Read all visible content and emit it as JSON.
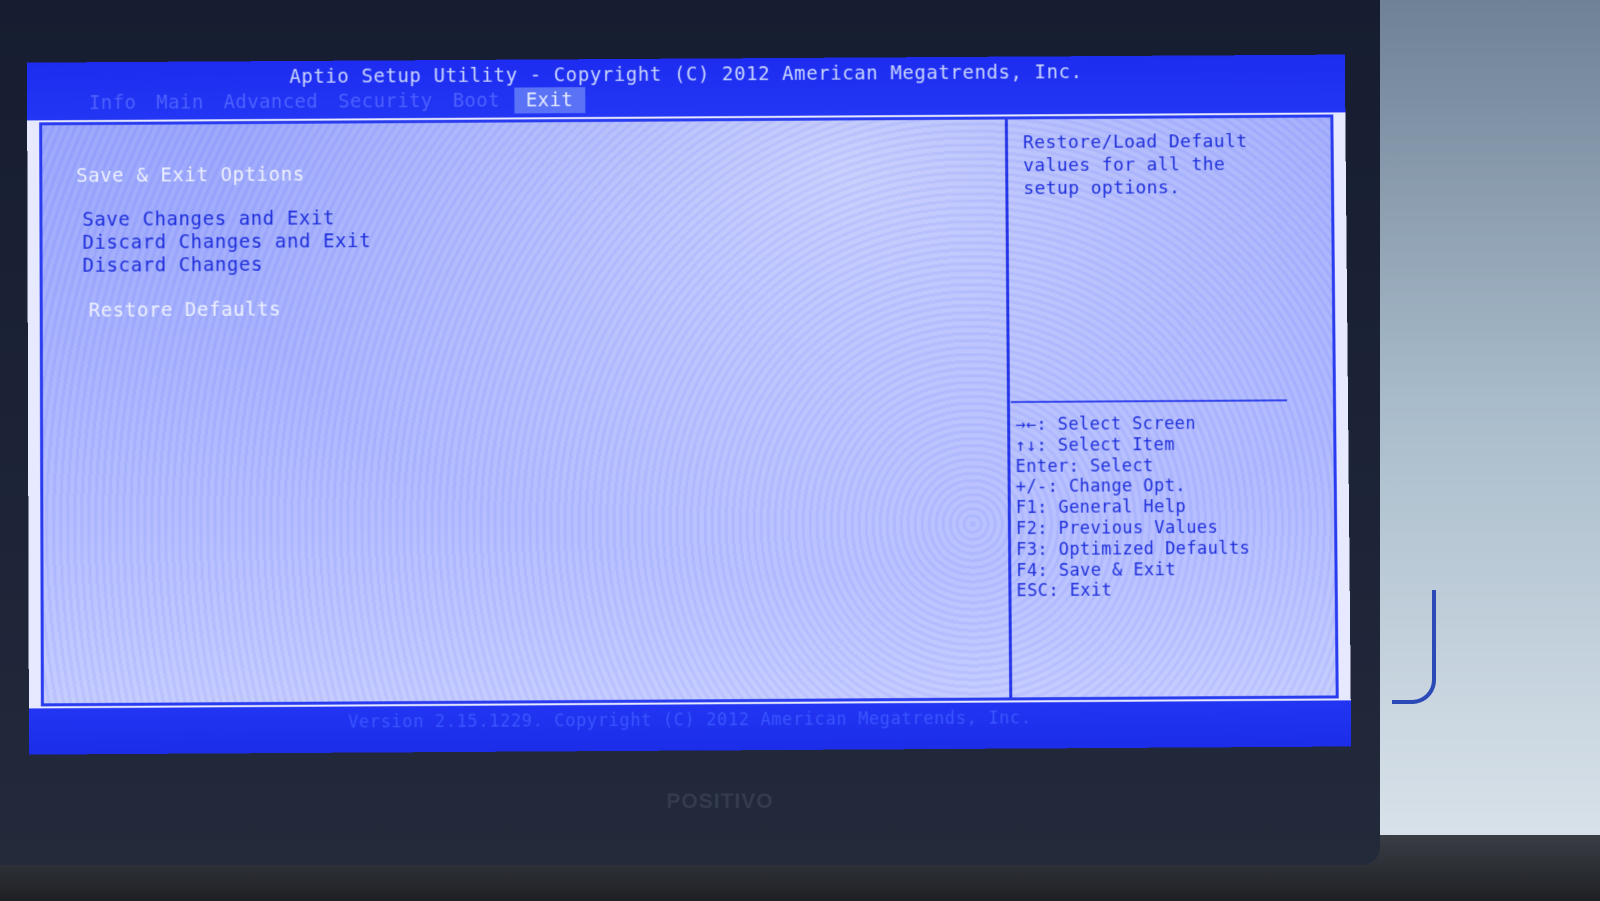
{
  "header": {
    "title": "Aptio Setup Utility - Copyright (C) 2012 American Megatrends, Inc.",
    "tabs": [
      {
        "label": "Info"
      },
      {
        "label": "Main"
      },
      {
        "label": "Advanced"
      },
      {
        "label": "Security"
      },
      {
        "label": "Boot"
      },
      {
        "label": "Exit",
        "active": true
      }
    ]
  },
  "main": {
    "section_title": "Save & Exit Options",
    "items": [
      {
        "label": "Save Changes and Exit"
      },
      {
        "label": "Discard Changes and Exit"
      },
      {
        "label": "Discard Changes"
      },
      {
        "label": "Restore Defaults",
        "selected": true
      }
    ]
  },
  "help_panel": {
    "description": "Restore/Load Default values for all the setup options.",
    "keys": [
      "→←: Select Screen",
      "↑↓: Select Item",
      "Enter: Select",
      "+/-: Change Opt.",
      "F1: General Help",
      "F2: Previous Values",
      "F3: Optimized Defaults",
      "F4: Save & Exit",
      "ESC: Exit"
    ]
  },
  "footer": {
    "version": "Version 2.15.1229. Copyright (C) 2012 American Megatrends, Inc."
  },
  "bezel": {
    "brand": "POSITIVO"
  },
  "colors": {
    "bios_blue": "#2336f4",
    "panel_bg": "#a4affd",
    "text_blue": "#1f2fdb",
    "highlight_text": "#eef1ff"
  }
}
